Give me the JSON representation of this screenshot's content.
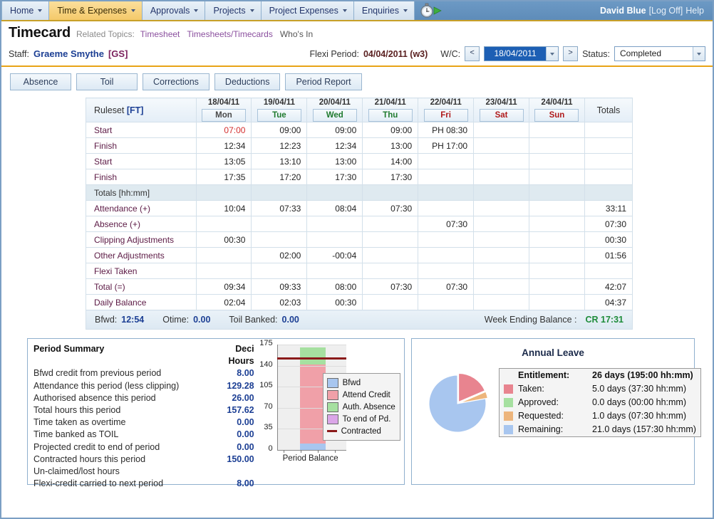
{
  "nav": {
    "items": [
      {
        "label": "Home",
        "active": false,
        "caret": true
      },
      {
        "label": "Time & Expenses",
        "active": true,
        "caret": true
      },
      {
        "label": "Approvals",
        "active": false,
        "caret": true
      },
      {
        "label": "Projects",
        "active": false,
        "caret": true
      },
      {
        "label": "Project Expenses",
        "active": false,
        "caret": true
      },
      {
        "label": "Enquiries",
        "active": false,
        "caret": true
      }
    ],
    "clock_icon": "stopwatch-icon",
    "user": "David Blue",
    "logoff": "[Log Off]",
    "help": "Help"
  },
  "header": {
    "page_title": "Timecard",
    "related_label": "Related Topics:",
    "related_links": [
      "Timesheet",
      "Timesheets/Timecards",
      "Who's In"
    ]
  },
  "info": {
    "staff_label": "Staff:",
    "staff_name": "Graeme Smythe",
    "staff_code": "[GS]",
    "flexi_label": "Flexi Period:",
    "flexi_value": "04/04/2011 (w3)",
    "wc_label": "W/C:",
    "prev_label": "<",
    "next_label": ">",
    "wc_value": "18/04/2011",
    "status_label": "Status:",
    "status_value": "Completed"
  },
  "buttons": [
    {
      "label": "Absence"
    },
    {
      "label": "Toil"
    },
    {
      "label": "Corrections"
    },
    {
      "label": "Deductions"
    },
    {
      "label": "Period Report"
    }
  ],
  "timecard": {
    "ruleset_label": "Ruleset",
    "ruleset_value": "[FT]",
    "totals_header": "Totals",
    "days": [
      {
        "date": "18/04/11",
        "day": "Mon",
        "color": "d-gray"
      },
      {
        "date": "19/04/11",
        "day": "Tue",
        "color": "d-green"
      },
      {
        "date": "20/04/11",
        "day": "Wed",
        "color": "d-green"
      },
      {
        "date": "21/04/11",
        "day": "Thu",
        "color": "d-green"
      },
      {
        "date": "22/04/11",
        "day": "Fri",
        "color": "d-red"
      },
      {
        "date": "23/04/11",
        "day": "Sat",
        "color": "d-red"
      },
      {
        "date": "24/04/11",
        "day": "Sun",
        "color": "d-red"
      }
    ],
    "rows": [
      {
        "label": "Start",
        "type": "data",
        "cells": [
          "07:00",
          "09:00",
          "09:00",
          "09:00",
          "PH 08:30",
          "",
          ""
        ],
        "total": "",
        "red_first": true
      },
      {
        "label": "Finish",
        "type": "data",
        "cells": [
          "12:34",
          "12:23",
          "12:34",
          "13:00",
          "PH 17:00",
          "",
          ""
        ],
        "total": ""
      },
      {
        "label": "Start",
        "type": "data",
        "cells": [
          "13:05",
          "13:10",
          "13:00",
          "14:00",
          "",
          "",
          ""
        ],
        "total": ""
      },
      {
        "label": "Finish",
        "type": "data",
        "cells": [
          "17:35",
          "17:20",
          "17:30",
          "17:30",
          "",
          "",
          ""
        ],
        "total": ""
      },
      {
        "label": "Totals [hh:mm]",
        "type": "sep",
        "cells": [
          "",
          "",
          "",
          "",
          "",
          "",
          ""
        ],
        "total": ""
      },
      {
        "label": "Attendance (+)",
        "type": "data",
        "cells": [
          "10:04",
          "07:33",
          "08:04",
          "07:30",
          "",
          "",
          ""
        ],
        "total": "33:11"
      },
      {
        "label": "Absence (+)",
        "type": "data",
        "cells": [
          "",
          "",
          "",
          "",
          "07:30",
          "",
          ""
        ],
        "total": "07:30"
      },
      {
        "label": "Clipping Adjustments",
        "type": "data",
        "cells": [
          "00:30",
          "",
          "",
          "",
          "",
          "",
          ""
        ],
        "total": "00:30"
      },
      {
        "label": "Other Adjustments",
        "type": "data",
        "cells": [
          "",
          "02:00",
          "-00:04",
          "",
          "",
          "",
          ""
        ],
        "total": "01:56"
      },
      {
        "label": "Flexi Taken",
        "type": "data",
        "cells": [
          "",
          "",
          "",
          "",
          "",
          "",
          ""
        ],
        "total": ""
      },
      {
        "label": "Total (=)",
        "type": "data",
        "cells": [
          "09:34",
          "09:33",
          "08:00",
          "07:30",
          "07:30",
          "",
          ""
        ],
        "total": "42:07"
      },
      {
        "label": "Daily Balance",
        "type": "data",
        "cells": [
          "02:04",
          "02:03",
          "00:30",
          "",
          "",
          "",
          ""
        ],
        "total": "04:37"
      }
    ],
    "footer": {
      "bfwd_label": "Bfwd:",
      "bfwd_value": "12:54",
      "otime_label": "Otime:",
      "otime_value": "0.00",
      "toil_label": "Toil Banked:",
      "toil_value": "0.00",
      "week_label": "Week Ending Balance :",
      "week_value": "CR 17:31"
    }
  },
  "period_summary": {
    "title": "Period Summary",
    "value_header": "Deci Hours",
    "rows": [
      {
        "label": "Bfwd credit from previous period",
        "value": "8.00"
      },
      {
        "label": "Attendance this period (less clipping)",
        "value": "129.28"
      },
      {
        "label": "Authorised absence this period",
        "value": "26.00"
      },
      {
        "label": "Total hours this period",
        "value": "157.62"
      },
      {
        "label": "Time taken as overtime",
        "value": "0.00"
      },
      {
        "label": "Time banked as TOIL",
        "value": "0.00"
      },
      {
        "label": "Projected credit to end of period",
        "value": "0.00"
      },
      {
        "label": "Contracted hours this period",
        "value": "150.00"
      },
      {
        "label": "Un-claimed/lost hours",
        "value": ""
      },
      {
        "label": "Flexi-credit carried to next period",
        "value": "8.00"
      }
    ]
  },
  "chart_data": [
    {
      "type": "bar",
      "title": "",
      "xlabel": "Period Balance",
      "ylabel": "",
      "categories": [
        "Period Balance"
      ],
      "ylim": [
        0,
        175
      ],
      "yticks": [
        0,
        35,
        70,
        105,
        140,
        175
      ],
      "grid": true,
      "stacked": true,
      "legend_position": "right",
      "series": [
        {
          "name": "Bfwd",
          "values": [
            8.0
          ],
          "color": "#a8c6ef"
        },
        {
          "name": "Attend Credit",
          "values": [
            129.28
          ],
          "color": "#f0a0a8"
        },
        {
          "name": "Auth. Absence",
          "values": [
            26.0
          ],
          "color": "#a6e0a0"
        },
        {
          "name": "To end of Pd.",
          "values": [
            0.0
          ],
          "color": "#dba6e8"
        }
      ],
      "reference_line": {
        "name": "Contracted",
        "value": 150.0,
        "color": "#8b1a1a"
      }
    },
    {
      "type": "pie",
      "title": "Annual Leave",
      "labels": [
        "Taken",
        "Approved",
        "Requested",
        "Remaining"
      ],
      "values": [
        5.0,
        0.0,
        1.0,
        21.0
      ],
      "colors": [
        "#e8848f",
        "#a6e0a0",
        "#edb57c",
        "#a8c6ef"
      ],
      "unit": "days",
      "legend_position": "right"
    }
  ],
  "annual_leave": {
    "title": "Annual Leave",
    "rows": [
      {
        "label": "Entitlement:",
        "value": "26 days (195:00 hh:mm)",
        "swatch": "",
        "head": true
      },
      {
        "label": "Taken:",
        "value": "5.0 days (37:30 hh:mm)",
        "swatch": "#e8848f",
        "head": false
      },
      {
        "label": "Approved:",
        "value": "0.0 days (00:00 hh:mm)",
        "swatch": "#a6e0a0",
        "head": false
      },
      {
        "label": "Requested:",
        "value": "1.0 days (07:30 hh:mm)",
        "swatch": "#edb57c",
        "head": false
      },
      {
        "label": "Remaining:",
        "value": "21.0 days (157:30 hh:mm)",
        "swatch": "#a8c6ef",
        "head": false
      }
    ]
  }
}
